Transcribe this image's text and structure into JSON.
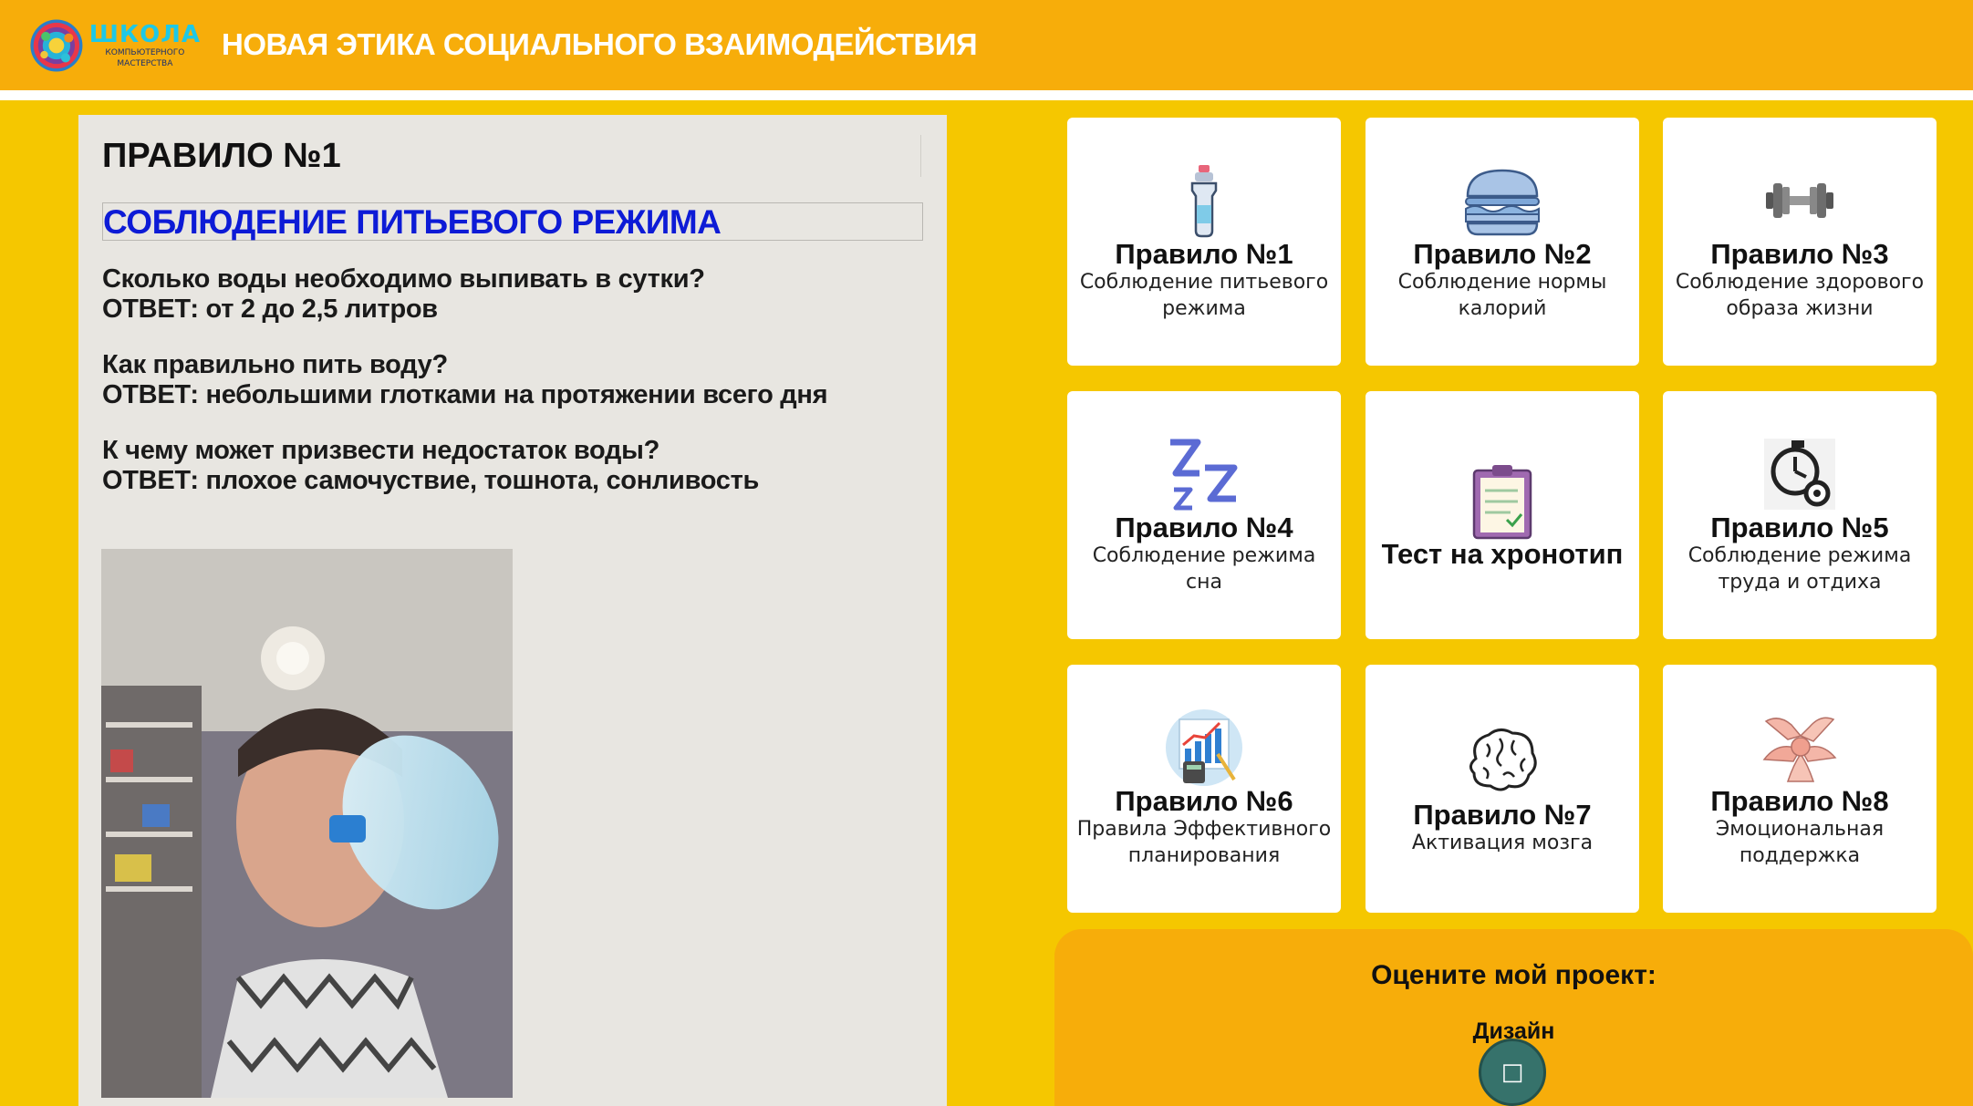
{
  "header": {
    "logo_main": "ШКОЛА",
    "logo_sub_1": "КОМПЬЮТЕРНОГО",
    "logo_sub_2": "МАСТЕРСТВА",
    "title": "НОВАЯ ЭТИКА СОЦИАЛЬНОГО ВЗАИМОДЕЙСТВИЯ"
  },
  "article": {
    "heading": "ПРАВИЛО №1",
    "subheading": "СОБЛЮДЕНИЕ ПИТЬЕВОГО РЕЖИМА",
    "qa": [
      {
        "q": "Сколько воды необходимо выпивать в сутки?",
        "a": "ОТВЕТ: от 2 до 2,5 литров"
      },
      {
        "q": "Как правильно пить воду?",
        "a": "ОТВЕТ: небольшими глотками на протяжении всего дня"
      },
      {
        "q": "К чему может призвести недостаток воды?",
        "a": "ОТВЕТ: плохое самочуствие, тошнота, сонливость"
      }
    ]
  },
  "cards": [
    {
      "title": "Правило №1",
      "desc": "Соблюдение питьевого режима",
      "icon": "water-bottle-icon"
    },
    {
      "title": "Правило №2",
      "desc": "Соблюдение нормы калорий",
      "icon": "burger-icon"
    },
    {
      "title": "Правило №3",
      "desc": "Соблюдение здорового образа жизни",
      "icon": "dumbbell-icon"
    },
    {
      "title": "Правило №4",
      "desc": "Соблюдение режима сна",
      "icon": "sleep-zzz-icon"
    },
    {
      "title": "Тест на хронотип",
      "desc": "",
      "icon": "clipboard-icon"
    },
    {
      "title": "Правило №5",
      "desc": "Соблюдение режима труда и отдиха",
      "icon": "stopwatch-gear-icon"
    },
    {
      "title": "Правило №6",
      "desc": "Правила Эффективного планирования",
      "icon": "planning-chart-icon"
    },
    {
      "title": "Правило №7",
      "desc": "Активация мозга",
      "icon": "brain-icon"
    },
    {
      "title": "Правило №8",
      "desc": "Эмоциональная поддержка",
      "icon": "hands-together-icon"
    }
  ],
  "rating": {
    "title": "Оцените мой проект:",
    "label": "Дизайн",
    "button_icon": "rate-icon"
  },
  "colors": {
    "page_bg": "#f5c700",
    "header_bg": "#f7ad0a",
    "subheading": "#0d1bd6",
    "rate_button": "#36726b"
  }
}
